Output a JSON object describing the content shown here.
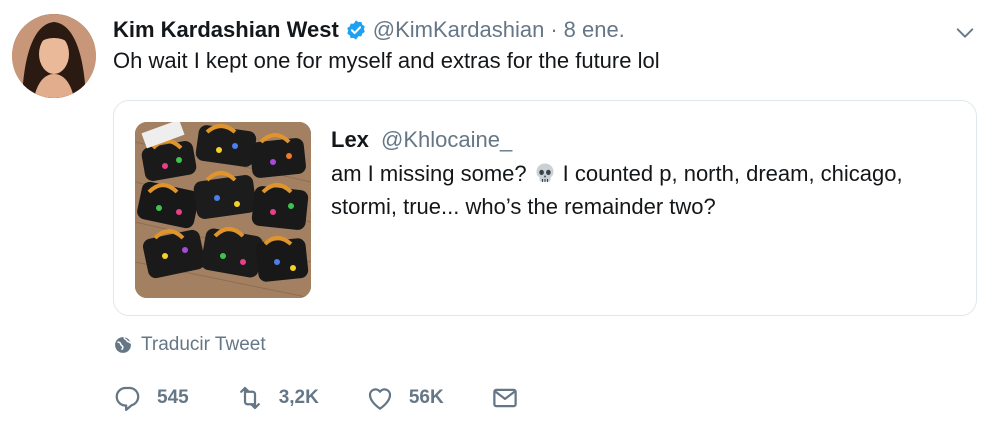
{
  "tweet": {
    "author_name": "Kim Kardashian West",
    "author_handle": "@KimKardashian",
    "separator": "·",
    "timestamp": "8 ene.",
    "text": "Oh wait I kept one for myself and extras for the future lol"
  },
  "quoted_tweet": {
    "author_name": "Lex",
    "author_handle": "@Khlocaine_",
    "text_before_emoji": "am I missing some?",
    "emoji": "skull-emoji",
    "text_after_emoji": "I counted p, north, dream, chicago, stormi, true... who’s the remainder two?"
  },
  "translate": {
    "label": "Traducir Tweet",
    "icon": "globe-icon"
  },
  "actions": {
    "reply_count": "545",
    "retweet_count": "3,2K",
    "like_count": "56K",
    "icons": [
      "reply-icon",
      "retweet-icon",
      "like-icon",
      "message-icon"
    ]
  },
  "colors": {
    "text": "#14171a",
    "secondary": "#657786",
    "border": "#e1e8ed",
    "verified": "#1da1f2"
  }
}
